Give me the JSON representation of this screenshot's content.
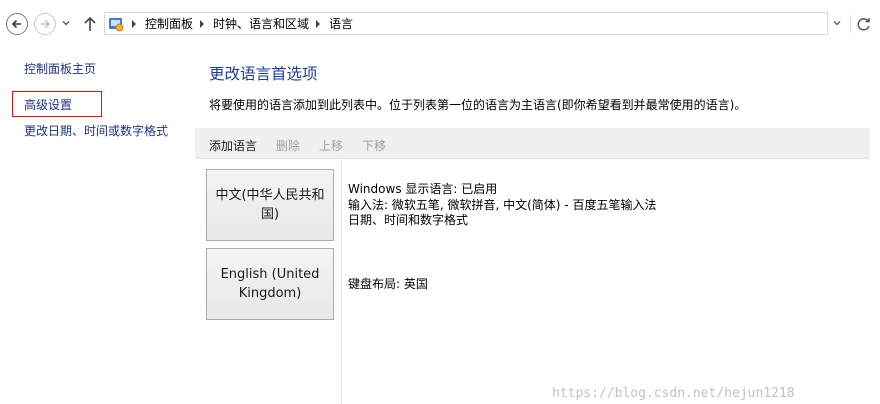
{
  "window": {
    "breadcrumb": [
      "控制面板",
      "时钟、语言和区域",
      "语言"
    ]
  },
  "sidebar": {
    "home": "控制面板主页",
    "advanced": "高级设置",
    "date_time": "更改日期、时间或数字格式"
  },
  "main": {
    "title": "更改语言首选项",
    "description": "将要使用的语言添加到此列表中。位于列表第一位的语言为主语言(即你希望看到并最常使用的语言)。",
    "toolbar": {
      "add": "添加语言",
      "remove": "删除",
      "move_up": "上移",
      "move_down": "下移"
    },
    "languages": [
      {
        "name": "中文(中华人民共和国)",
        "details": [
          "Windows 显示语言: 已启用",
          "输入法: 微软五笔, 微软拼音, 中文(简体) - 百度五笔输入法",
          "日期、时间和数字格式"
        ]
      },
      {
        "name": "English (United Kingdom)",
        "details": [
          "键盘布局: 英国"
        ]
      }
    ]
  },
  "watermark": "https://blog.csdn.net/hejun1218",
  "colors": {
    "link": "#1e3287",
    "title": "#1e3d96",
    "highlight_box": "#e0101a",
    "toolbar_bg": "#f0f0f0",
    "disabled": "#a0a0a0"
  },
  "icons": [
    "back-arrow-icon",
    "forward-arrow-icon",
    "chevron-down-icon",
    "up-arrow-icon",
    "control-panel-icon",
    "refresh-icon"
  ]
}
